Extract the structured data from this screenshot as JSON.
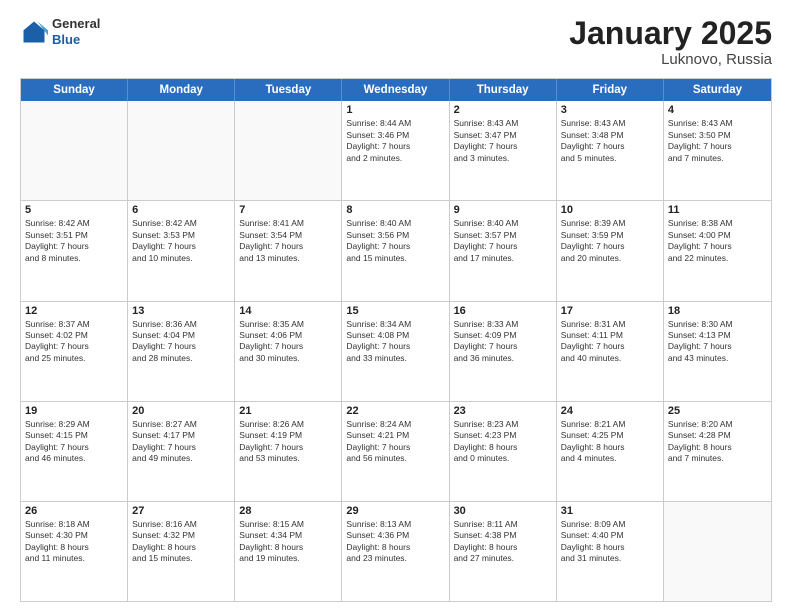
{
  "header": {
    "logo": {
      "general": "General",
      "blue": "Blue"
    },
    "title": "January 2025",
    "subtitle": "Luknovo, Russia"
  },
  "calendar": {
    "weekdays": [
      "Sunday",
      "Monday",
      "Tuesday",
      "Wednesday",
      "Thursday",
      "Friday",
      "Saturday"
    ],
    "rows": [
      [
        {
          "day": "",
          "empty": true,
          "lines": []
        },
        {
          "day": "",
          "empty": true,
          "lines": []
        },
        {
          "day": "",
          "empty": true,
          "lines": []
        },
        {
          "day": "1",
          "empty": false,
          "lines": [
            "Sunrise: 8:44 AM",
            "Sunset: 3:46 PM",
            "Daylight: 7 hours",
            "and 2 minutes."
          ]
        },
        {
          "day": "2",
          "empty": false,
          "lines": [
            "Sunrise: 8:43 AM",
            "Sunset: 3:47 PM",
            "Daylight: 7 hours",
            "and 3 minutes."
          ]
        },
        {
          "day": "3",
          "empty": false,
          "lines": [
            "Sunrise: 8:43 AM",
            "Sunset: 3:48 PM",
            "Daylight: 7 hours",
            "and 5 minutes."
          ]
        },
        {
          "day": "4",
          "empty": false,
          "lines": [
            "Sunrise: 8:43 AM",
            "Sunset: 3:50 PM",
            "Daylight: 7 hours",
            "and 7 minutes."
          ]
        }
      ],
      [
        {
          "day": "5",
          "empty": false,
          "lines": [
            "Sunrise: 8:42 AM",
            "Sunset: 3:51 PM",
            "Daylight: 7 hours",
            "and 8 minutes."
          ]
        },
        {
          "day": "6",
          "empty": false,
          "lines": [
            "Sunrise: 8:42 AM",
            "Sunset: 3:53 PM",
            "Daylight: 7 hours",
            "and 10 minutes."
          ]
        },
        {
          "day": "7",
          "empty": false,
          "lines": [
            "Sunrise: 8:41 AM",
            "Sunset: 3:54 PM",
            "Daylight: 7 hours",
            "and 13 minutes."
          ]
        },
        {
          "day": "8",
          "empty": false,
          "lines": [
            "Sunrise: 8:40 AM",
            "Sunset: 3:56 PM",
            "Daylight: 7 hours",
            "and 15 minutes."
          ]
        },
        {
          "day": "9",
          "empty": false,
          "lines": [
            "Sunrise: 8:40 AM",
            "Sunset: 3:57 PM",
            "Daylight: 7 hours",
            "and 17 minutes."
          ]
        },
        {
          "day": "10",
          "empty": false,
          "lines": [
            "Sunrise: 8:39 AM",
            "Sunset: 3:59 PM",
            "Daylight: 7 hours",
            "and 20 minutes."
          ]
        },
        {
          "day": "11",
          "empty": false,
          "lines": [
            "Sunrise: 8:38 AM",
            "Sunset: 4:00 PM",
            "Daylight: 7 hours",
            "and 22 minutes."
          ]
        }
      ],
      [
        {
          "day": "12",
          "empty": false,
          "lines": [
            "Sunrise: 8:37 AM",
            "Sunset: 4:02 PM",
            "Daylight: 7 hours",
            "and 25 minutes."
          ]
        },
        {
          "day": "13",
          "empty": false,
          "lines": [
            "Sunrise: 8:36 AM",
            "Sunset: 4:04 PM",
            "Daylight: 7 hours",
            "and 28 minutes."
          ]
        },
        {
          "day": "14",
          "empty": false,
          "lines": [
            "Sunrise: 8:35 AM",
            "Sunset: 4:06 PM",
            "Daylight: 7 hours",
            "and 30 minutes."
          ]
        },
        {
          "day": "15",
          "empty": false,
          "lines": [
            "Sunrise: 8:34 AM",
            "Sunset: 4:08 PM",
            "Daylight: 7 hours",
            "and 33 minutes."
          ]
        },
        {
          "day": "16",
          "empty": false,
          "lines": [
            "Sunrise: 8:33 AM",
            "Sunset: 4:09 PM",
            "Daylight: 7 hours",
            "and 36 minutes."
          ]
        },
        {
          "day": "17",
          "empty": false,
          "lines": [
            "Sunrise: 8:31 AM",
            "Sunset: 4:11 PM",
            "Daylight: 7 hours",
            "and 40 minutes."
          ]
        },
        {
          "day": "18",
          "empty": false,
          "lines": [
            "Sunrise: 8:30 AM",
            "Sunset: 4:13 PM",
            "Daylight: 7 hours",
            "and 43 minutes."
          ]
        }
      ],
      [
        {
          "day": "19",
          "empty": false,
          "lines": [
            "Sunrise: 8:29 AM",
            "Sunset: 4:15 PM",
            "Daylight: 7 hours",
            "and 46 minutes."
          ]
        },
        {
          "day": "20",
          "empty": false,
          "lines": [
            "Sunrise: 8:27 AM",
            "Sunset: 4:17 PM",
            "Daylight: 7 hours",
            "and 49 minutes."
          ]
        },
        {
          "day": "21",
          "empty": false,
          "lines": [
            "Sunrise: 8:26 AM",
            "Sunset: 4:19 PM",
            "Daylight: 7 hours",
            "and 53 minutes."
          ]
        },
        {
          "day": "22",
          "empty": false,
          "lines": [
            "Sunrise: 8:24 AM",
            "Sunset: 4:21 PM",
            "Daylight: 7 hours",
            "and 56 minutes."
          ]
        },
        {
          "day": "23",
          "empty": false,
          "lines": [
            "Sunrise: 8:23 AM",
            "Sunset: 4:23 PM",
            "Daylight: 8 hours",
            "and 0 minutes."
          ]
        },
        {
          "day": "24",
          "empty": false,
          "lines": [
            "Sunrise: 8:21 AM",
            "Sunset: 4:25 PM",
            "Daylight: 8 hours",
            "and 4 minutes."
          ]
        },
        {
          "day": "25",
          "empty": false,
          "lines": [
            "Sunrise: 8:20 AM",
            "Sunset: 4:28 PM",
            "Daylight: 8 hours",
            "and 7 minutes."
          ]
        }
      ],
      [
        {
          "day": "26",
          "empty": false,
          "lines": [
            "Sunrise: 8:18 AM",
            "Sunset: 4:30 PM",
            "Daylight: 8 hours",
            "and 11 minutes."
          ]
        },
        {
          "day": "27",
          "empty": false,
          "lines": [
            "Sunrise: 8:16 AM",
            "Sunset: 4:32 PM",
            "Daylight: 8 hours",
            "and 15 minutes."
          ]
        },
        {
          "day": "28",
          "empty": false,
          "lines": [
            "Sunrise: 8:15 AM",
            "Sunset: 4:34 PM",
            "Daylight: 8 hours",
            "and 19 minutes."
          ]
        },
        {
          "day": "29",
          "empty": false,
          "lines": [
            "Sunrise: 8:13 AM",
            "Sunset: 4:36 PM",
            "Daylight: 8 hours",
            "and 23 minutes."
          ]
        },
        {
          "day": "30",
          "empty": false,
          "lines": [
            "Sunrise: 8:11 AM",
            "Sunset: 4:38 PM",
            "Daylight: 8 hours",
            "and 27 minutes."
          ]
        },
        {
          "day": "31",
          "empty": false,
          "lines": [
            "Sunrise: 8:09 AM",
            "Sunset: 4:40 PM",
            "Daylight: 8 hours",
            "and 31 minutes."
          ]
        },
        {
          "day": "",
          "empty": true,
          "lines": []
        }
      ]
    ]
  }
}
